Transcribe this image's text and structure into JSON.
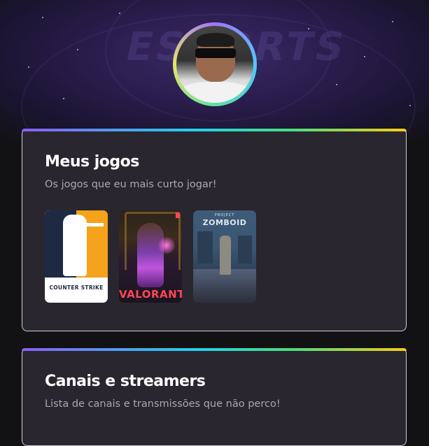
{
  "profile": {
    "avatar_icon": "profile-photo",
    "ring_colors": [
      "#9f75ff",
      "#4ec7ff",
      "#5fe0a0",
      "#e8e46a"
    ]
  },
  "hero": {
    "background_logo_text": "ESPORTS"
  },
  "sections": [
    {
      "title": "Meus jogos",
      "subtitle": "Os jogos que eu mais curto jogar!",
      "games": [
        {
          "name": "Counter Strike",
          "caption": "COUNTER STRIKE"
        },
        {
          "name": "Valorant",
          "caption": "VALORANT"
        },
        {
          "name": "Project Zomboid",
          "caption_top": "PROJECT",
          "caption": "ZOMBOID"
        }
      ]
    },
    {
      "title": "Canais e streamers",
      "subtitle": "Lista de canais e transmissões que não perco!"
    }
  ],
  "colors": {
    "page_bg": "#121214",
    "card_bg": "#29262f",
    "title": "#ffffff",
    "subtitle": "#a8a8b3",
    "accent_gradient": [
      "#8b5cf6",
      "#22d3ee",
      "#4ade80",
      "#facc15"
    ]
  }
}
